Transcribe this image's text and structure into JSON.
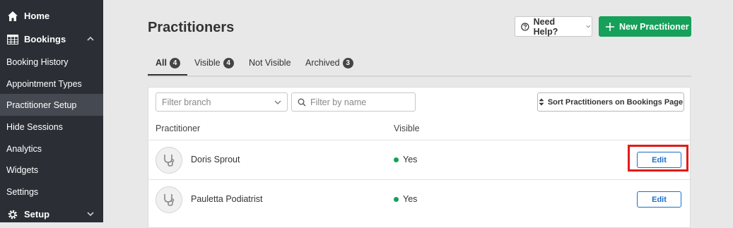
{
  "sidebar": {
    "items": [
      {
        "label": "Home",
        "icon": "home-icon",
        "kind": "top"
      },
      {
        "label": "Bookings",
        "icon": "table-icon",
        "kind": "top",
        "chevron": "up"
      },
      {
        "label": "Booking History",
        "kind": "sub"
      },
      {
        "label": "Appointment Types",
        "kind": "sub"
      },
      {
        "label": "Practitioner Setup",
        "kind": "sub",
        "active": true
      },
      {
        "label": "Hide Sessions",
        "kind": "sub"
      },
      {
        "label": "Analytics",
        "kind": "sub"
      },
      {
        "label": "Widgets",
        "kind": "sub"
      },
      {
        "label": "Settings",
        "kind": "sub"
      },
      {
        "label": "Setup",
        "icon": "gear-icon",
        "kind": "top",
        "chevron": "down"
      }
    ]
  },
  "header": {
    "title": "Practitioners",
    "help_label": "Need Help?",
    "new_label": "New Practitioner"
  },
  "tabs": [
    {
      "label": "All",
      "count": "4",
      "active": true
    },
    {
      "label": "Visible",
      "count": "4"
    },
    {
      "label": "Not Visible",
      "count": ""
    },
    {
      "label": "Archived",
      "count": "3"
    }
  ],
  "filters": {
    "branch_placeholder": "Filter branch",
    "name_placeholder": "Filter by name",
    "sort_label": "Sort Practitioners on Bookings Page"
  },
  "table": {
    "columns": [
      "Practitioner",
      "Visible"
    ],
    "edit_label": "Edit",
    "rows": [
      {
        "name": "Doris Sprout",
        "visible": "Yes"
      },
      {
        "name": "Pauletta Podiatrist",
        "visible": "Yes"
      }
    ]
  },
  "colors": {
    "accent_green": "#16a05a",
    "link_blue": "#1a6fc9",
    "highlight_red": "#e11b1b",
    "sidebar_bg": "#2b2f35"
  }
}
